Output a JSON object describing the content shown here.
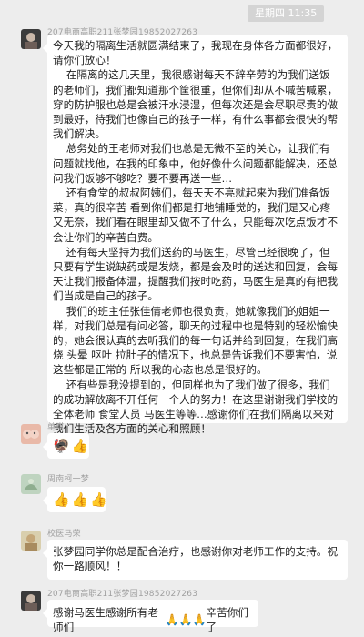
{
  "timestamp": "星期四 11:35",
  "messages": [
    {
      "sender": "207电商高职211张梦园19852027263",
      "paragraphs": [
        "今天我的隔离生活就圆满结束了，我现在身体各方面都很好，请你们放心！",
        "    在隔离的这几天里，我很感谢每天不辞辛劳的为我们送饭的老师们，我们都知道那个筐很重，但你们却从不喊苦喊累，穿的防护服也总是会被汗水浸湿，但每次还是会尽职尽责的做到最好，待我们也像自己的孩子一样，有什么事都会很快的帮我们解决。",
        "    总务处的王老师对我们也总是无微不至的关心，让我们有问题就找他，在我的印象中，他好像什么问题都能解决，还总问我们饭够不够吃？要不要再送一些…",
        "    还有食堂的叔叔阿姨们，每天天不亮就起来为我们准备饭菜，真的很辛苦 看到你们都是打地铺睡觉的，我们是又心疼又无奈，我们看在眼里却又做不了什么，只能每次吃点饭才不会让你们的辛苦白费。",
        "    还有每天坚持为我们送药的马医生，尽管已经很晚了，但只要有学生说缺药或是发烧，都是会及时的送达和回复，会每天让我们报备体温，提醒我们按时吃药，马医生是真的有把我们当成是自己的孩子。",
        "    我们的班主任张佳倩老师也很负责，她就像我们的姐姐一样，对我们总是有问必答，聊天的过程中也是特别的轻松愉快的，她会很认真的去听我们的每一句话并给到回复，在我们高烧 头晕 呕吐 拉肚子的情况下，也总是告诉我们不要害怕，说这些都是正常的 所以我的心态也总是很好的。",
        "    还有些是我没提到的，但同样也为了我们做了很多，我们的成功解放离不开任何一个人的努力！在这里谢谢我们学校的全体老师 食堂人员 马医生等等…感谢你们在我们隔离以来对我们生活及各方面的关心和照顾！"
      ]
    },
    {
      "sender": "单琪",
      "emojis": [
        "🦃",
        "👍"
      ]
    },
    {
      "sender": "周南柯一梦",
      "emojis": [
        "👍",
        "👍",
        "👍"
      ]
    },
    {
      "sender": "校医马荣",
      "text": "张梦园同学你总是配合治疗，也感谢你对老师工作的支持。祝你一路顺风！！"
    },
    {
      "sender": "207电商高职211张梦园19852027263",
      "text_before": "感谢马医生感谢所有老师们",
      "emojis": [
        "🙏",
        "🙏",
        "🙏"
      ],
      "text_after": "辛苦你们了"
    }
  ]
}
